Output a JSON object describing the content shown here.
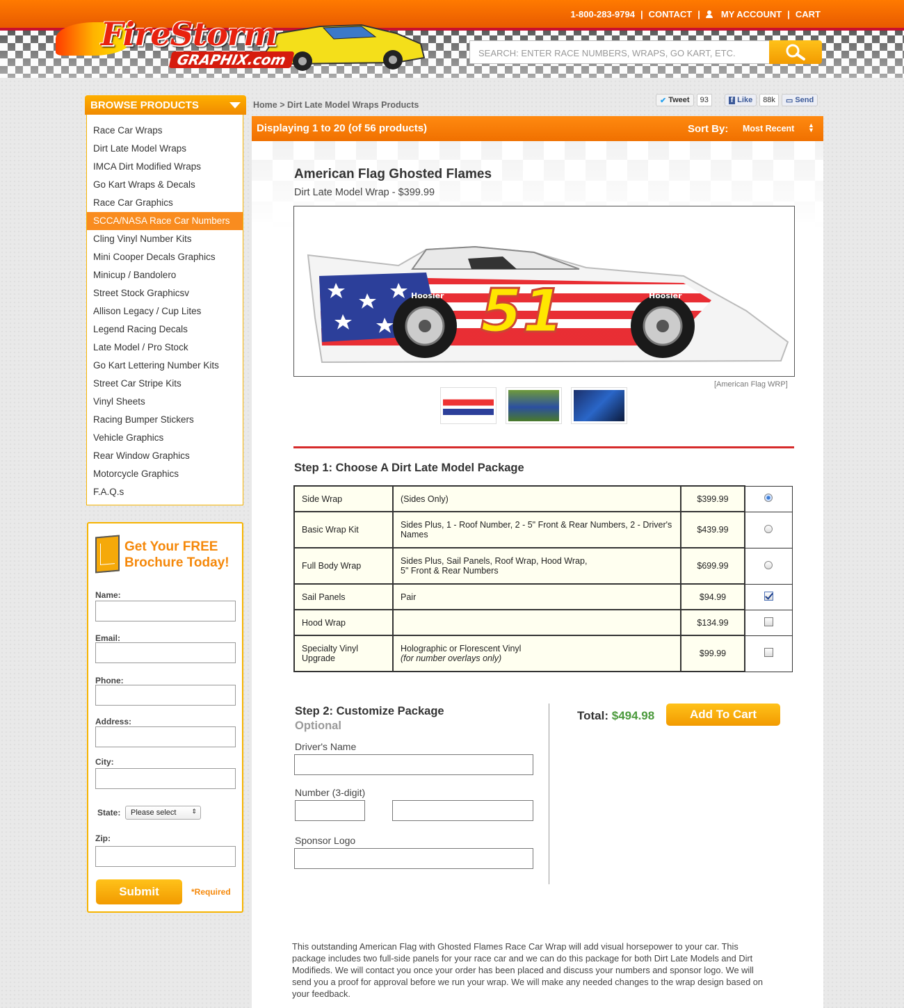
{
  "header": {
    "phone": "1-800-283-9794",
    "contact": "CONTACT",
    "my_account": "MY ACCOUNT",
    "cart": "CART",
    "logo_main": "FireStorm",
    "logo_sub": "GRAPHIX.com",
    "search_placeholder": "SEARCH:  ENTER RACE NUMBERS, WRAPS, GO KART, ETC."
  },
  "sidebar": {
    "browse_title": "BROWSE PRODUCTS",
    "items": [
      "Race Car Wraps",
      "Dirt Late Model Wraps",
      "IMCA Dirt Modified Wraps",
      "Go Kart Wraps & Decals",
      "Race Car Graphics",
      "SCCA/NASA Race Car Numbers",
      "Cling Vinyl Number Kits",
      "Mini Cooper Decals Graphics",
      "Minicup / Bandolero",
      "Street Stock Graphicsv",
      "Allison Legacy / Cup Lites",
      "Legend Racing Decals",
      "Late Model / Pro Stock",
      "Go Kart Lettering Number Kits",
      "Street Car Stripe Kits",
      "Vinyl Sheets",
      "Racing Bumper Stickers",
      "Vehicle Graphics",
      "Rear Window Graphics",
      "Motorcycle Graphics",
      "F.A.Q.s"
    ],
    "active_index": 5
  },
  "brochure": {
    "title_line1": "Get Your FREE",
    "title_line2": "Brochure Today!",
    "name_label": "Name:",
    "email_label": "Email:",
    "phone_label": "Phone:",
    "address_label": "Address:",
    "city_label": "City:",
    "state_label": "State:",
    "state_value": "Please select",
    "zip_label": "Zip:",
    "submit": "Submit",
    "required": "*Required"
  },
  "breadcrumb": "Home > Dirt Late Model Wraps Products",
  "social": {
    "tweet": "Tweet",
    "tweet_count": "93",
    "like": "Like",
    "like_count": "88k",
    "send": "Send"
  },
  "listing": {
    "displaying": "Displaying 1 to 20 (of 56 products)",
    "sort_label": "Sort By:",
    "sort_value": "Most Recent"
  },
  "product": {
    "title": "American Flag Ghosted Flames",
    "subtitle": "Dirt Late Model Wrap - $399.99",
    "car_number": "51",
    "tire_brand": "Hoosier",
    "image_caption": "[American Flag WRP]"
  },
  "step1": {
    "title": "Step 1: Choose A Dirt Late Model Package",
    "rows": [
      {
        "name": "Side Wrap",
        "desc": "(Sides Only)",
        "desc2": "",
        "price": "$399.99"
      },
      {
        "name": "Basic Wrap Kit",
        "desc": "Sides Plus, 1 - Roof Number, 2 - 5\" Front & Rear Numbers, 2 - Driver's Names",
        "desc2": "",
        "price": "$439.99"
      },
      {
        "name": "Full Body Wrap",
        "desc": "Sides Plus, Sail Panels, Roof Wrap, Hood Wrap,",
        "desc2": "5\" Front & Rear Numbers",
        "price": "$699.99"
      },
      {
        "name": "Sail Panels",
        "desc": "Pair",
        "desc2": "",
        "price": "$94.99"
      },
      {
        "name": "Hood Wrap",
        "desc": "",
        "desc2": "",
        "price": "$134.99"
      },
      {
        "name": "Specialty Vinyl Upgrade",
        "desc": "Holographic or Florescent Vinyl",
        "desc2": "(for number overlays only)",
        "price": "$99.99"
      }
    ]
  },
  "step2": {
    "title": "Step 2: Customize Package",
    "optional": "Optional",
    "drivers_name": "Driver's Name",
    "number": "Number (3-digit)",
    "sponsor": "Sponsor Logo"
  },
  "total": {
    "label": "Total:",
    "value": "$494.98",
    "add_to_cart": "Add To Cart"
  },
  "description": "This outstanding American Flag with Ghosted Flames Race Car Wrap will add visual horsepower to your car. This package includes two full-side panels for your race car and we can do this package for both Dirt Late Models and Dirt Modifieds. We will contact you once your order has been placed and discuss your numbers and sponsor logo. We will send you a proof for approval before we run your wrap. We will make any needed changes to the wrap design based on your feedback.",
  "colors": {
    "accent": "#f98c1f",
    "price_green": "#4b9a3c",
    "red": "#d62b2b"
  }
}
